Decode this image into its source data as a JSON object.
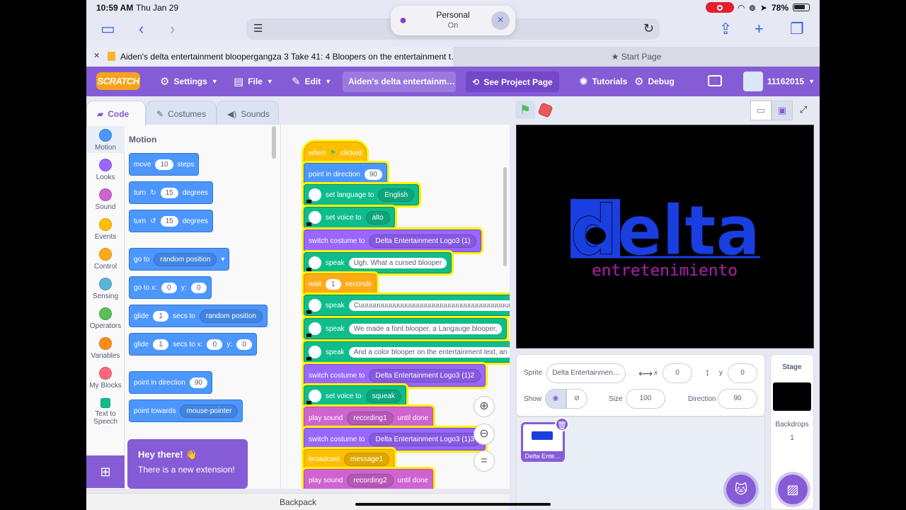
{
  "status": {
    "time": "10:59 AM",
    "date": "Thu Jan 29",
    "battery": "78%"
  },
  "browser": {
    "personal_title": "Personal",
    "personal_state": "On",
    "tab_active": "Aiden's delta entertainment bloopergangza 3 Take 41: 4 Bloopers on the entertainment t…",
    "tab_other": "Start Page"
  },
  "menu": {
    "logo": "SCRATCH",
    "settings": "Settings",
    "file": "File",
    "edit": "Edit",
    "project_title": "Aiden's delta entertainm…",
    "see_project": "See Project Page",
    "tutorials": "Tutorials",
    "debug": "Debug",
    "username": "11162015"
  },
  "editor_tabs": {
    "code": "Code",
    "costumes": "Costumes",
    "sounds": "Sounds"
  },
  "categories": [
    {
      "label": "Motion",
      "color": "#4c97ff"
    },
    {
      "label": "Looks",
      "color": "#9966ff"
    },
    {
      "label": "Sound",
      "color": "#cf63cf"
    },
    {
      "label": "Events",
      "color": "#ffbf00"
    },
    {
      "label": "Control",
      "color": "#ffab19"
    },
    {
      "label": "Sensing",
      "color": "#5cb1d6"
    },
    {
      "label": "Operators",
      "color": "#59c059"
    },
    {
      "label": "Variables",
      "color": "#ff8c1a"
    },
    {
      "label": "My Blocks",
      "color": "#ff6680"
    },
    {
      "label": "Text to Speech",
      "color": "#0fbd8c"
    }
  ],
  "palette": {
    "title": "Motion",
    "move": {
      "a": "move",
      "v": "10",
      "b": "steps"
    },
    "turn_right": {
      "a": "turn",
      "v": "15",
      "b": "degrees"
    },
    "turn_left": {
      "a": "turn",
      "v": "15",
      "b": "degrees"
    },
    "goto": {
      "a": "go to",
      "d": "random position"
    },
    "gotoxy": {
      "a": "go to x:",
      "x": "0",
      "b": "y:",
      "y": "0"
    },
    "glide_rand": {
      "a": "glide",
      "v": "1",
      "b": "secs to",
      "d": "random position"
    },
    "glide_xy": {
      "a": "glide",
      "v": "1",
      "b": "secs to x:",
      "x": "0",
      "c": "y:",
      "y": "0"
    },
    "point_dir": {
      "a": "point in direction",
      "v": "90"
    },
    "point_towards": {
      "a": "point towards",
      "d": "mouse-pointer"
    }
  },
  "script": {
    "when": "when",
    "clicked": "clicked",
    "point_dir": {
      "a": "point in direction",
      "v": "90"
    },
    "set_lang": {
      "a": "set language to",
      "d": "English"
    },
    "set_voice": {
      "a": "set voice to",
      "d": "alto"
    },
    "switch1": {
      "a": "switch costume to",
      "d": "Delta Entertainment Logo3 (1)"
    },
    "speak1": {
      "a": "speak",
      "v": "Ugh. What a cursed blooper"
    },
    "wait": {
      "a": "wait",
      "v": "1",
      "b": "seconds"
    },
    "speak2": {
      "a": "speak",
      "v": "Cuuuuuuuuuuuuuuuuuuuuuuuuuuuuuuuuuuuuuuu"
    },
    "speak3": {
      "a": "speak",
      "v": "We made a font blooper, a Langauge blooper,"
    },
    "speak4": {
      "a": "speak",
      "v": "And a color blooper on the entertainment text, an"
    },
    "switch2": {
      "a": "switch costume to",
      "d": "Delta Entertainment Logo3 (1)2"
    },
    "set_voice2": {
      "a": "set voice to",
      "d": "squeak"
    },
    "play1": {
      "a": "play sound",
      "d": "recording1",
      "b": "until done"
    },
    "switch3": {
      "a": "switch costume to",
      "d": "Delta Entertainment Logo3 (1)3"
    },
    "broadcast": {
      "a": "broadcast",
      "d": "message1"
    },
    "play2": {
      "a": "play sound",
      "d": "recording2",
      "b": "until done"
    }
  },
  "bubble": {
    "title": "Hey there! 👋",
    "text": "There is a new extension!"
  },
  "backpack": "Backpack",
  "stage_content": {
    "logo_word": "delta",
    "logo_sub": "entretenimiento",
    "logo_color": "#1a3fe0",
    "sub_color": "#e0141e"
  },
  "sprite": {
    "label": "Sprite",
    "name": "Delta Entertainmen…",
    "x_label": "x",
    "x": "0",
    "y_label": "y",
    "y": "0",
    "show_label": "Show",
    "size_label": "Size",
    "size": "100",
    "direction_label": "Direction",
    "direction": "90",
    "thumb_label": "Delta Ente…"
  },
  "stage_panel": {
    "title": "Stage",
    "backdrops_label": "Backdrops",
    "backdrops_count": "1"
  }
}
